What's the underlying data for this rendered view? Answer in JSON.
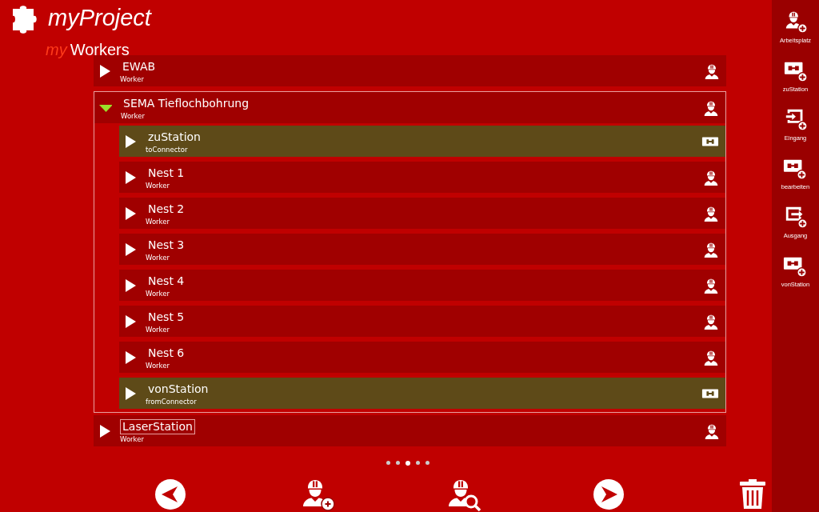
{
  "header": {
    "title": "myProject",
    "subtitle_prefix": "my",
    "subtitle": "Workers"
  },
  "tree": [
    {
      "name": "EWAB",
      "type_label": "Worker",
      "kind": "worker",
      "expanded": false,
      "focused": false
    },
    {
      "name": "SEMA Tieflochbohrung",
      "type_label": "Worker",
      "kind": "worker",
      "expanded": true,
      "focused": false,
      "children": [
        {
          "name": "zuStation",
          "type_label": "toConnector",
          "kind": "connector",
          "expanded": false,
          "focused": false
        },
        {
          "name": "Nest 1",
          "type_label": "Worker",
          "kind": "worker",
          "expanded": false,
          "focused": false
        },
        {
          "name": "Nest 2",
          "type_label": "Worker",
          "kind": "worker",
          "expanded": false,
          "focused": false
        },
        {
          "name": "Nest 3",
          "type_label": "Worker",
          "kind": "worker",
          "expanded": false,
          "focused": false
        },
        {
          "name": "Nest 4",
          "type_label": "Worker",
          "kind": "worker",
          "expanded": false,
          "focused": false
        },
        {
          "name": "Nest 5",
          "type_label": "Worker",
          "kind": "worker",
          "expanded": false,
          "focused": false
        },
        {
          "name": "Nest 6",
          "type_label": "Worker",
          "kind": "worker",
          "expanded": false,
          "focused": false
        },
        {
          "name": "vonStation",
          "type_label": "fromConnector",
          "kind": "connector",
          "expanded": false,
          "focused": false
        }
      ]
    },
    {
      "name": "LaserStation",
      "type_label": "Worker",
      "kind": "worker",
      "expanded": false,
      "focused": true
    }
  ],
  "pager": [
    {
      "selected": false
    },
    {
      "selected": false
    },
    {
      "selected": true
    },
    {
      "selected": false
    },
    {
      "selected": false
    }
  ],
  "toolbar": [
    {
      "label": "Arbeitsplatz",
      "kind": "worker"
    },
    {
      "label": "zuStation",
      "kind": "connector"
    },
    {
      "label": "Eingang",
      "kind": "input"
    },
    {
      "label": "bearbeiten",
      "kind": "connector"
    },
    {
      "label": "Ausgang",
      "kind": "output"
    },
    {
      "label": "vonStation",
      "kind": "connector"
    }
  ]
}
